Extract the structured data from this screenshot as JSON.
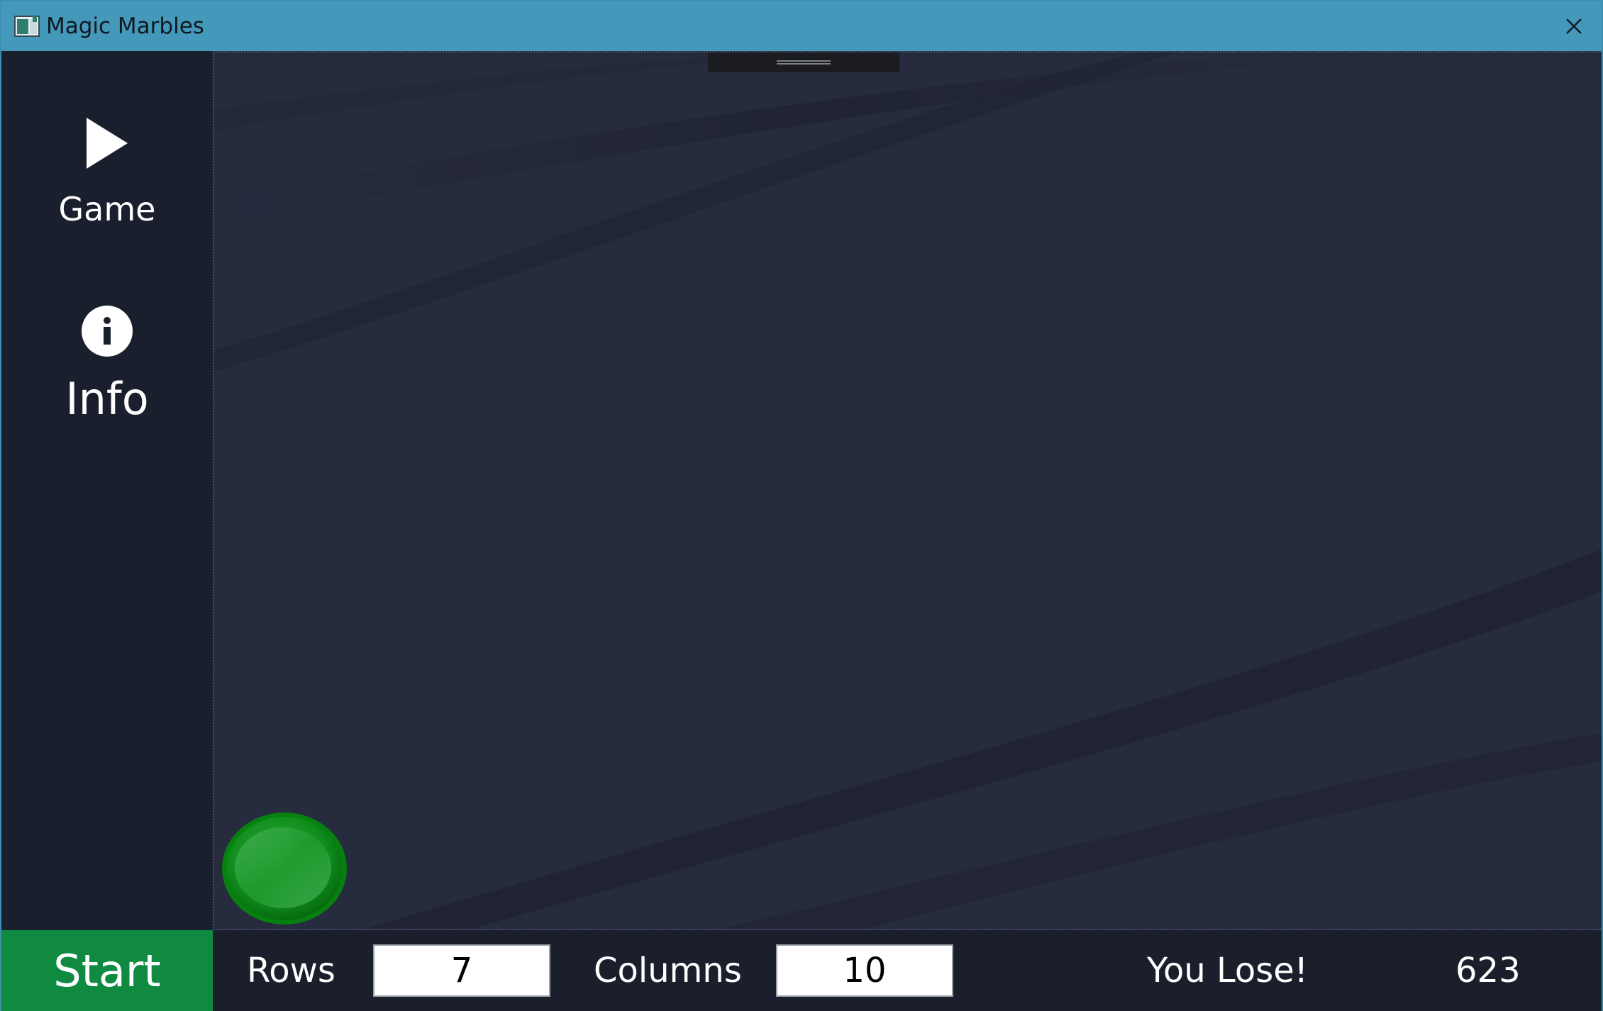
{
  "window": {
    "title": "Magic Marbles",
    "icon": "app-window-icon",
    "close_icon": "close-icon"
  },
  "colors": {
    "titlebar": "#4498ba",
    "sidebar": "#1a1f2d",
    "playarea": "#262b3e",
    "start_button": "#0f8a40",
    "marble": "#0a8a0a"
  },
  "sidebar": {
    "items": [
      {
        "label": "Game",
        "icon": "play-icon"
      },
      {
        "label": "Info",
        "icon": "info-icon"
      }
    ]
  },
  "board": {
    "marbles": [
      {
        "color": "green"
      }
    ]
  },
  "bottombar": {
    "start_label": "Start",
    "rows_label": "Rows",
    "rows_value": "7",
    "columns_label": "Columns",
    "columns_value": "10",
    "status": "You Lose!",
    "score": "623"
  }
}
